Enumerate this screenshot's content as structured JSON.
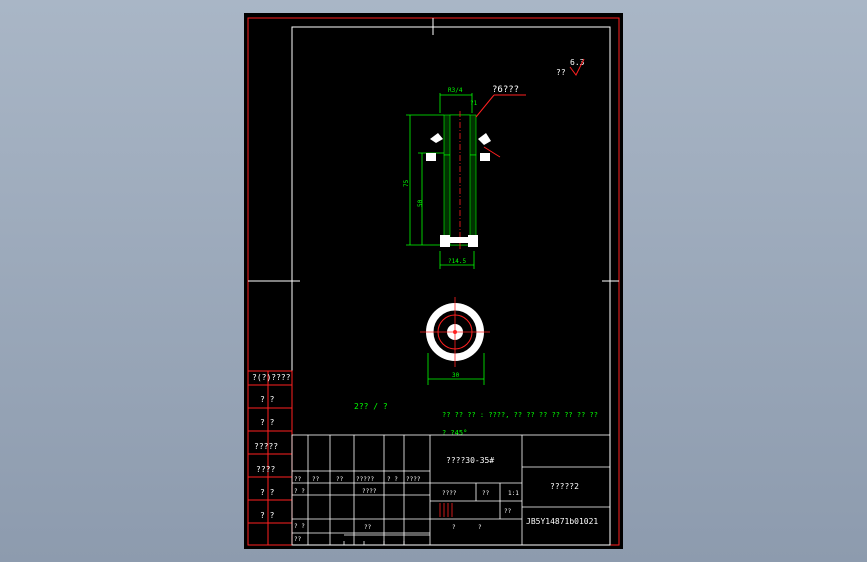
{
  "drawing": {
    "roughness_symbol": "??",
    "roughness_value": "6.3",
    "callout_top": "?6???",
    "dim_thread": "R3/4",
    "dim_chamfer": "?1",
    "dim_total_length": "75",
    "dim_shank_length": "50",
    "dim_bottom_diameter": "?14.5",
    "dim_head_diameter": "30",
    "scale_note": "2?? / ?",
    "tech_req_line1": "?? ?? ?? : ????, ?? ?? ?? ?? ?? ?? ??",
    "tech_req_line2": "? ?45°"
  },
  "left_strip": {
    "labels": [
      "?(?)????",
      "?  ?",
      "?  ?",
      "?????",
      "????",
      "?  ?",
      "?  ?"
    ]
  },
  "title_block": {
    "material": "????30-35#",
    "part_name": "?????2",
    "drawing_number": "JB5Y14871b01021",
    "row1": [
      "??",
      "??",
      "??",
      "?????",
      "?  ?",
      "????"
    ],
    "row2": [
      "?  ?",
      "????",
      "????",
      "??",
      "??"
    ],
    "row3": [
      "?  ?",
      "??",
      "?",
      "?",
      "??"
    ],
    "scale_box": "1:1"
  }
}
